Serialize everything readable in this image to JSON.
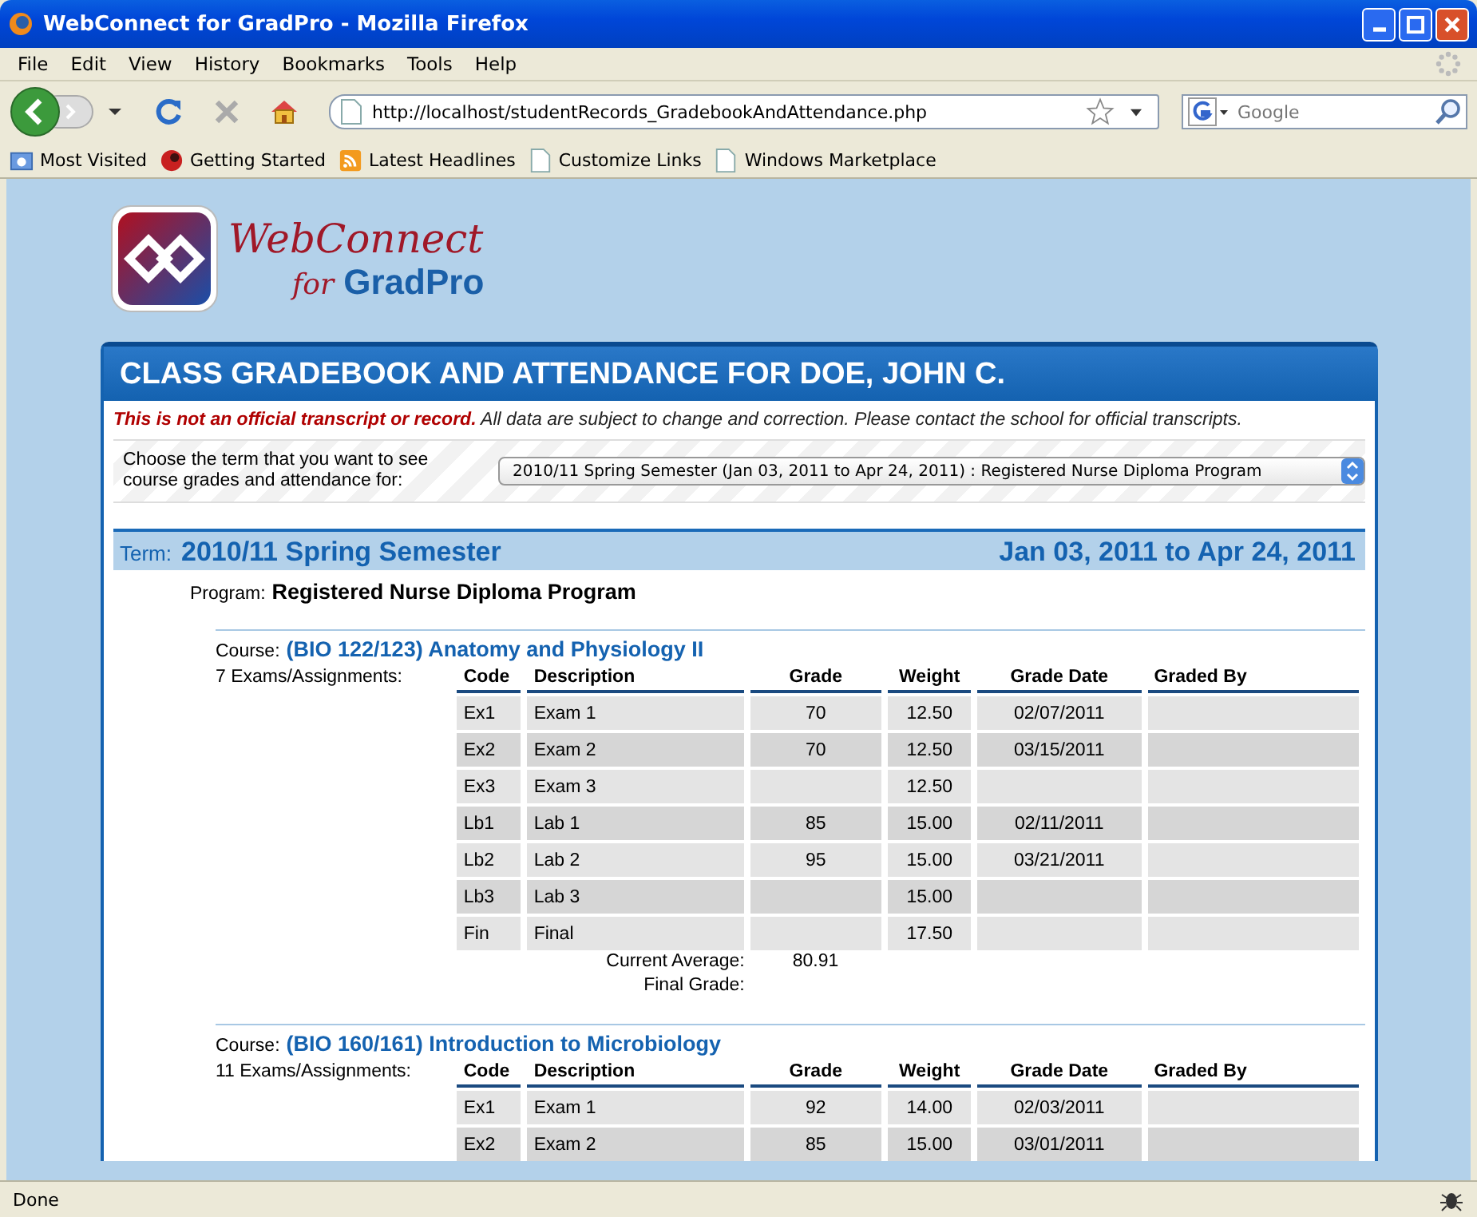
{
  "browser": {
    "title": "WebConnect for GradPro - Mozilla Firefox",
    "menu": [
      "File",
      "Edit",
      "View",
      "History",
      "Bookmarks",
      "Tools",
      "Help"
    ],
    "url": "http://localhost/studentRecords_GradebookAndAttendance.php",
    "search": {
      "placeholder": "Google"
    },
    "bookmarks": [
      {
        "label": "Most Visited",
        "kind": "folder"
      },
      {
        "label": "Getting Started",
        "kind": "fox"
      },
      {
        "label": "Latest Headlines",
        "kind": "feed"
      },
      {
        "label": "Customize Links",
        "kind": "page"
      },
      {
        "label": "Windows Marketplace",
        "kind": "page"
      }
    ],
    "status": "Done"
  },
  "page": {
    "logo": {
      "line1": "WebConnect",
      "for": "for",
      "line2": "GradPro"
    },
    "heading": "CLASS GRADEBOOK AND ATTENDANCE FOR DOE, JOHN C.",
    "disclaimer": {
      "warning": "This is not an official transcript or record.",
      "rest": "All data are subject to change and correction. Please contact the school for official transcripts."
    },
    "term_chooser": {
      "label": "Choose the term that you want to see course grades and attendance for:",
      "value": "2010/11 Spring Semester (Jan 03, 2011 to Apr 24, 2011) : Registered Nurse Diploma Program"
    },
    "term": {
      "label": "Term:",
      "name": "2010/11 Spring Semester",
      "dates": "Jan 03, 2011 to Apr 24, 2011"
    },
    "program": {
      "label": "Program:",
      "name": "Registered Nurse Diploma Program"
    },
    "courses": [
      {
        "label": "Course:",
        "title": "(BIO 122/123) Anatomy and Physiology II",
        "count": "7 Exams/Assignments:",
        "columns": [
          "Code",
          "Description",
          "Grade",
          "Weight",
          "Grade Date",
          "Graded By"
        ],
        "rows": [
          [
            "Ex1",
            "Exam 1",
            "70",
            "12.50",
            "02/07/2011",
            ""
          ],
          [
            "Ex2",
            "Exam 2",
            "70",
            "12.50",
            "03/15/2011",
            ""
          ],
          [
            "Ex3",
            "Exam 3",
            "",
            "12.50",
            "",
            ""
          ],
          [
            "Lb1",
            "Lab 1",
            "85",
            "15.00",
            "02/11/2011",
            ""
          ],
          [
            "Lb2",
            "Lab 2",
            "95",
            "15.00",
            "03/21/2011",
            ""
          ],
          [
            "Lb3",
            "Lab 3",
            "",
            "15.00",
            "",
            ""
          ],
          [
            "Fin",
            "Final",
            "",
            "17.50",
            "",
            ""
          ]
        ],
        "summary": [
          {
            "label": "Current Average:",
            "value": "80.91"
          },
          {
            "label": "Final Grade:"
          }
        ]
      },
      {
        "label": "Course:",
        "title": "(BIO 160/161) Introduction to Microbiology",
        "count": "11 Exams/Assignments:",
        "columns": [
          "Code",
          "Description",
          "Grade",
          "Weight",
          "Grade Date",
          "Graded By"
        ],
        "rows": [
          [
            "Ex1",
            "Exam 1",
            "92",
            "14.00",
            "02/03/2011",
            ""
          ],
          [
            "Ex2",
            "Exam 2",
            "85",
            "15.00",
            "03/01/2011",
            ""
          ]
        ]
      }
    ]
  }
}
